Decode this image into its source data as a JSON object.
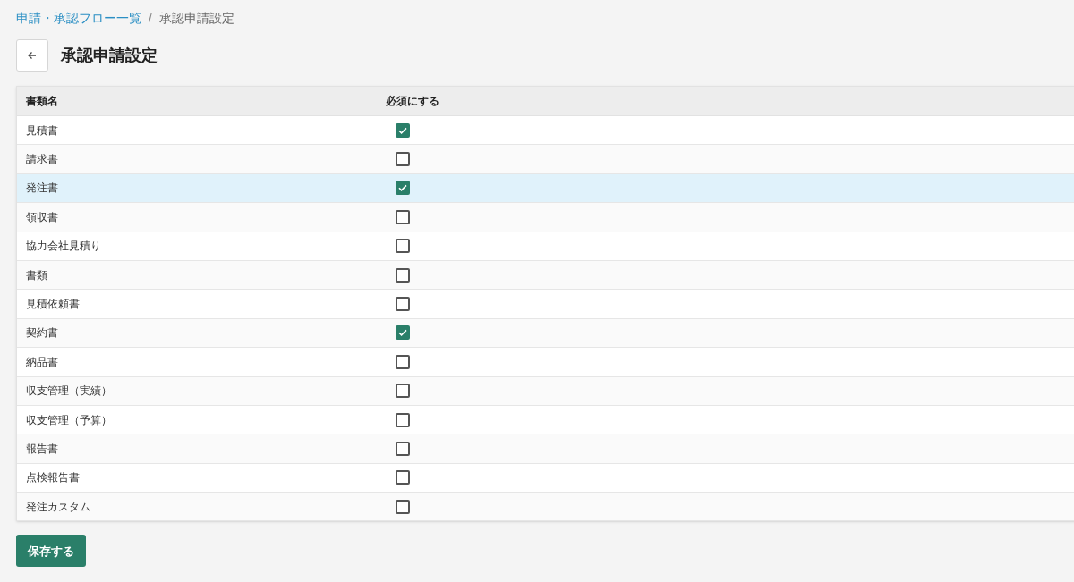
{
  "breadcrumb": [
    {
      "label": "申請・承認フロー一覧",
      "kind": "link"
    },
    {
      "label": "/",
      "kind": "separator"
    },
    {
      "label": "承認申請設定",
      "kind": "current"
    }
  ],
  "page": {
    "title": "承認申請設定"
  },
  "table": {
    "columns": [
      "書類名",
      "必須にする"
    ],
    "rows": [
      {
        "name": "見積書",
        "checked": true,
        "highlighted": false
      },
      {
        "name": "請求書",
        "checked": false,
        "highlighted": false
      },
      {
        "name": "発注書",
        "checked": true,
        "highlighted": true
      },
      {
        "name": "領収書",
        "checked": false,
        "highlighted": false
      },
      {
        "name": "協力会社見積り",
        "checked": false,
        "highlighted": false
      },
      {
        "name": "書類",
        "checked": false,
        "highlighted": false
      },
      {
        "name": "見積依頼書",
        "checked": false,
        "highlighted": false
      },
      {
        "name": "契約書",
        "checked": true,
        "highlighted": false
      },
      {
        "name": "納品書",
        "checked": false,
        "highlighted": false
      },
      {
        "name": "収支管理（実績）",
        "checked": false,
        "highlighted": false
      },
      {
        "name": "収支管理（予算）",
        "checked": false,
        "highlighted": false
      },
      {
        "name": "報告書",
        "checked": false,
        "highlighted": false
      },
      {
        "name": "点検報告書",
        "checked": false,
        "highlighted": false
      },
      {
        "name": "発注カスタム",
        "checked": false,
        "highlighted": false
      }
    ]
  },
  "save_button": "保存する"
}
